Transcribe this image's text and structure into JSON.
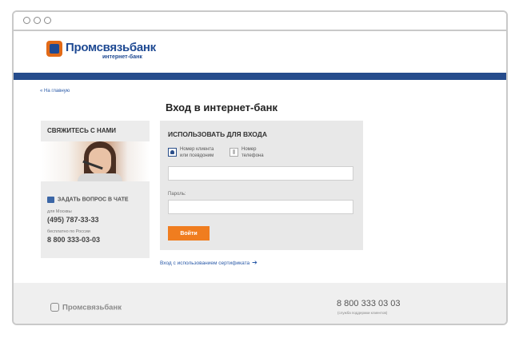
{
  "browser": {
    "window_controls": [
      "circle",
      "circle",
      "circle"
    ]
  },
  "header": {
    "brand_name": "Промсвязьбанк",
    "brand_sub": "интернет-банк",
    "brand_color": "#1f4a93",
    "logo_accent": "#e26a17",
    "band_color": "#264c8c"
  },
  "nav": {
    "back_link": "« На главную"
  },
  "page": {
    "title": "Вход в интернет-банк"
  },
  "contact": {
    "title": "СВЯЖИТЕСЬ С НАМИ",
    "chat_label": "ЗАДАТЬ ВОПРОС В ЧАТЕ",
    "moscow_label": "для Москвы",
    "moscow_phone": "(495) 787-33-33",
    "russia_label": "бесплатно по России",
    "russia_phone": "8 800 333-03-03"
  },
  "login": {
    "title": "ИСПОЛЬЗОВАТЬ ДЛЯ ВХОДА",
    "option_client": "Номер клиента или псевдоним",
    "option_client_line1": "Номер клиента",
    "option_client_line2": "или псевдоним",
    "option_phone_line1": "Номер",
    "option_phone_line2": "телефона",
    "login_value": "",
    "password_label": "Пароль:",
    "password_value": "",
    "submit_label": "Войти",
    "submit_color": "#f07d1f"
  },
  "certificate_link": "Вход с использованием сертификата",
  "footer": {
    "brand_name": "Промсвязьбанк",
    "phone": "8 800 333 03 03",
    "phone_note": "(служба поддержки клиентов)"
  }
}
